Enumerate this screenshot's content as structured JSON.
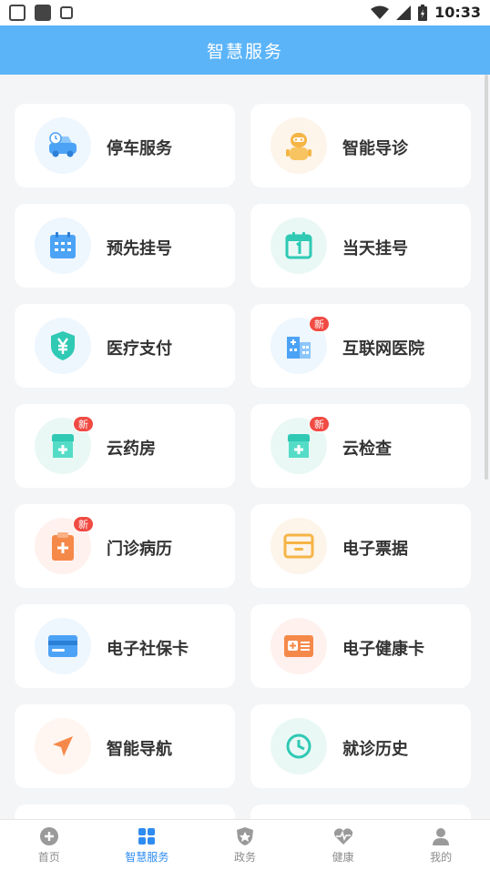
{
  "status": {
    "time": "10:33"
  },
  "header": {
    "title": "智慧服务"
  },
  "badge_new": "新",
  "services": [
    {
      "label": "停车服务",
      "icon": "car-icon"
    },
    {
      "label": "智能导诊",
      "icon": "robot-icon"
    },
    {
      "label": "预先挂号",
      "icon": "calendar-icon"
    },
    {
      "label": "当天挂号",
      "icon": "calendar-today-icon"
    },
    {
      "label": "医疗支付",
      "icon": "yuan-shield-icon"
    },
    {
      "label": "互联网医院",
      "icon": "hospital-building-icon"
    },
    {
      "label": "云药房",
      "icon": "pharmacy-icon"
    },
    {
      "label": "云检查",
      "icon": "checkup-icon"
    },
    {
      "label": "门诊病历",
      "icon": "clipboard-icon"
    },
    {
      "label": "电子票据",
      "icon": "receipt-icon"
    },
    {
      "label": "电子社保卡",
      "icon": "card-icon"
    },
    {
      "label": "电子健康卡",
      "icon": "health-card-icon"
    },
    {
      "label": "智能导航",
      "icon": "navigation-icon"
    },
    {
      "label": "就诊历史",
      "icon": "clock-icon"
    }
  ],
  "tabs": [
    {
      "label": "首页",
      "icon": "plus-circle-icon"
    },
    {
      "label": "智慧服务",
      "icon": "grid-icon",
      "active": true
    },
    {
      "label": "政务",
      "icon": "badge-icon"
    },
    {
      "label": "健康",
      "icon": "heartbeat-icon"
    },
    {
      "label": "我的",
      "icon": "user-icon"
    }
  ],
  "colors": {
    "header": "#5bb4f8",
    "active_tab": "#2e8cf0",
    "badge": "#f04b43"
  }
}
